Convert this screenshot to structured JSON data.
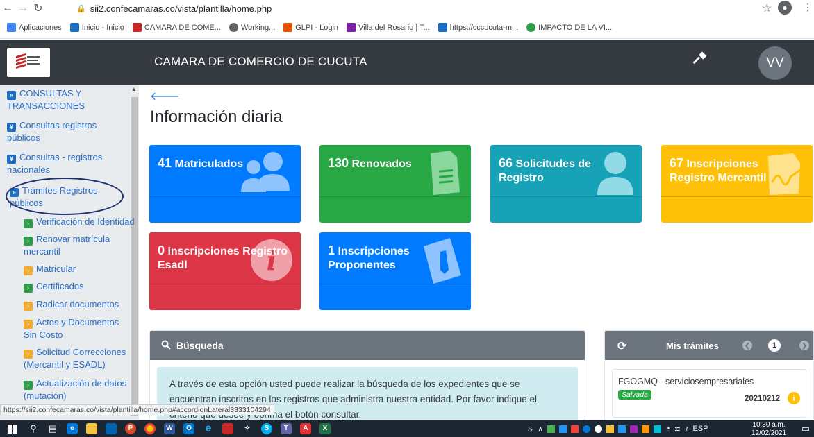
{
  "browser": {
    "url": "sii2.confecamaras.co/vista/plantilla/home.php",
    "bookmarks": [
      "Aplicaciones",
      "Inicio - Inicio",
      "CAMARA DE COME...",
      "Working...",
      "GLPI - Login",
      "Villa del Rosario | T...",
      "https://cccucuta-m...",
      "IMPACTO DE LA VI..."
    ],
    "bookmark_colors": [
      "#4285f4",
      "#1b6ec2",
      "#c62828",
      "#5f6368",
      "#e65100",
      "#c62828",
      "#7b1fa2",
      "#1b6ec2",
      "#2e9e4a"
    ]
  },
  "header": {
    "title": "CAMARA DE COMERCIO DE CUCUTA",
    "logo_text": "CÁMARA DE COMERCIO DE CÚCUTA",
    "avatar_initials": "VV"
  },
  "sidebar": {
    "section": "CONSULTAS Y TRANSACCIONES",
    "groups": [
      "Consultas registros públicos",
      "Consultas - registros nacionales",
      "Trámites Registros públicos"
    ],
    "items": [
      "Verificación de Identidad",
      "Renovar matrícula mercantil",
      "Matricular",
      "Certificados",
      "Radicar documentos",
      "Actos y Documentos Sin Costo",
      "Solicitud Correcciones (Mercantil y ESADL)",
      "Actualización de datos (mutación)"
    ]
  },
  "main": {
    "title": "Información diaria",
    "cards": [
      {
        "count": "41",
        "label": "Matriculados",
        "color": "#007bff"
      },
      {
        "count": "130",
        "label": "Renovados",
        "color": "#28a745"
      },
      {
        "count": "66",
        "label": "Solicitudes de Registro",
        "color": "#17a2b8"
      },
      {
        "count": "67",
        "label": "Inscripciones Registro Mercantil",
        "color": "#ffc107"
      },
      {
        "count": "0",
        "label": "Inscripciones Registro Esadl",
        "color": "#dc3545"
      },
      {
        "count": "1",
        "label": "Inscripciones Proponentes",
        "color": "#007bff"
      }
    ],
    "search": {
      "title": "Búsqueda",
      "text": "A través de esta opción usted puede realizar la búsqueda de los expedientes que se encuentran inscritos en los registros que administra nuestra entidad. Por favor indique el criterio que desee y oprima el botón consultar."
    },
    "mis_tramites": {
      "title": "Mis trámites",
      "page": "1",
      "item_name": "FGOGMQ - serviciosempresariales",
      "item_status": "Salvada",
      "item_code": "20210212"
    }
  },
  "status_url": "https://sii2.confecamaras.co/vista/plantilla/home.php#accordionLateral3333104294",
  "taskbar": {
    "language": "ESP",
    "time": "10:30 a.m.",
    "date": "12/02/2021"
  }
}
